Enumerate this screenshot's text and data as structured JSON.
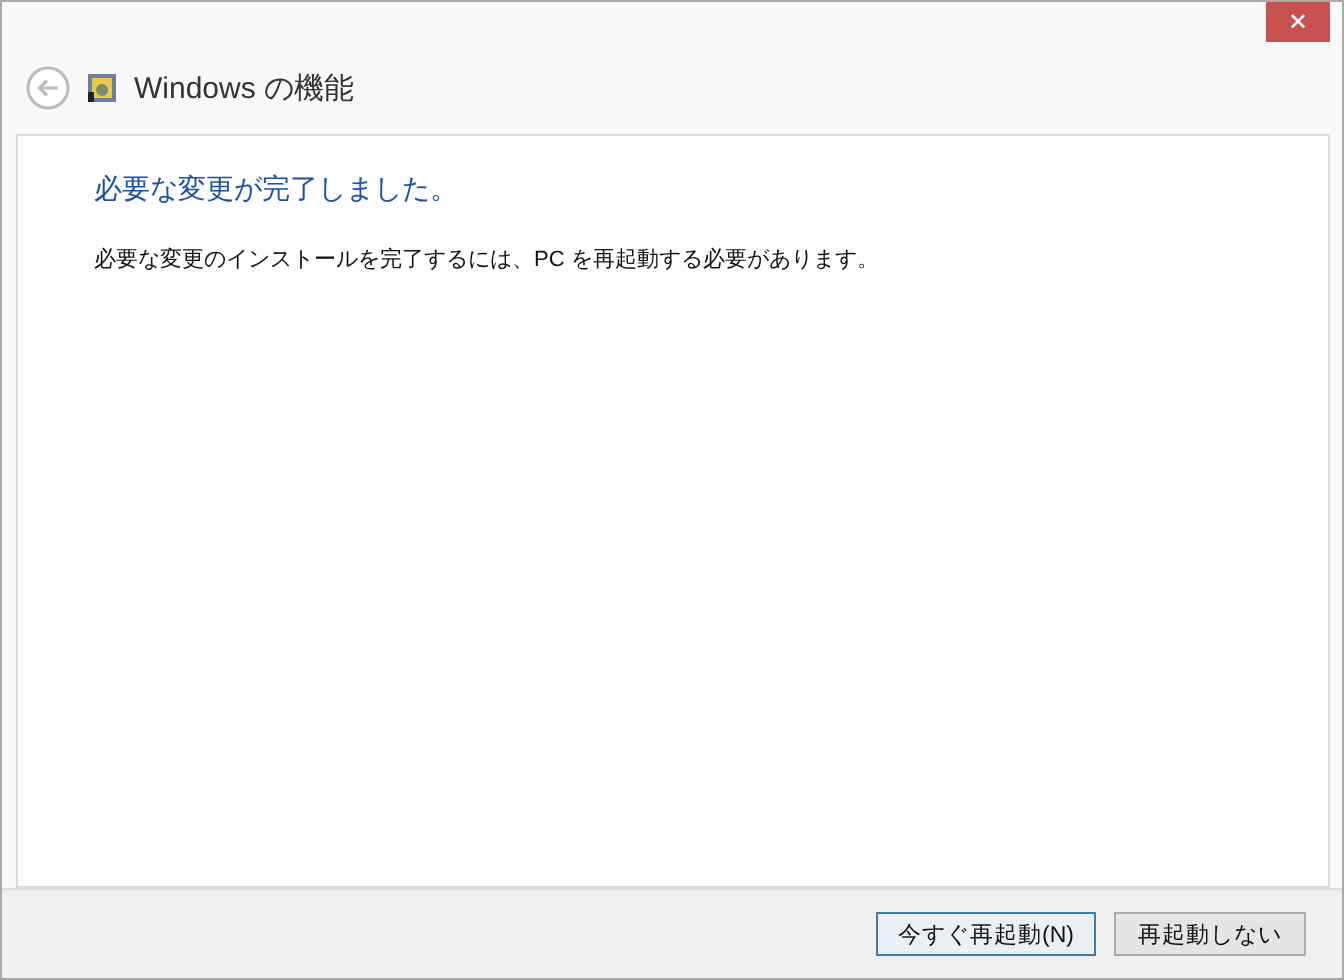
{
  "window": {
    "close_glyph": "✕",
    "title": "Windows の機能"
  },
  "heading": "必要な変更が完了しました。",
  "message": "必要な変更のインストールを完了するには、PC を再起動する必要があります。",
  "buttons": [
    {
      "label": "今すぐ再起動(N)",
      "default": true
    },
    {
      "label": "再起動しない",
      "default": false
    }
  ]
}
